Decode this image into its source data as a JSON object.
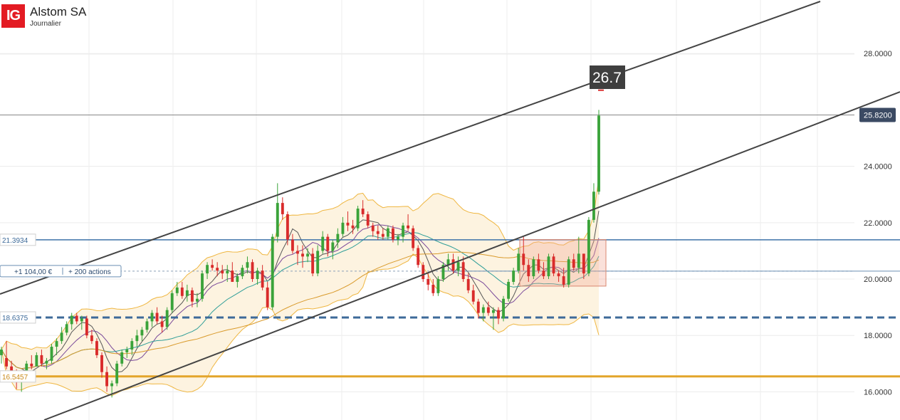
{
  "header": {
    "logo": "IG",
    "title": "Alstom SA",
    "subtitle": "Journalier"
  },
  "chart_data": {
    "type": "candlestick",
    "title": "Alstom SA",
    "subtitle": "Journalier",
    "ylim": [
      15.0,
      29.9
    ],
    "y_ticks": [
      "28.0000",
      "24.0000",
      "22.0000",
      "20.0000",
      "18.0000",
      "16.0000"
    ],
    "y_tick_values": [
      28.0,
      24.0,
      22.0,
      20.0,
      18.0,
      16.0
    ],
    "grid": true,
    "last_price": 25.82,
    "last_price_label": "25.8200",
    "target_value": 26.7,
    "target_label": "26.7",
    "levels": [
      {
        "value": 21.3934,
        "label": "21.3934",
        "color": "#3d72a8",
        "style": "solid"
      },
      {
        "value": 18.6375,
        "label": "18.6375",
        "color": "#3d6a99",
        "style": "dashed"
      },
      {
        "value": 16.5457,
        "label": "16.5457",
        "color": "#e3a52b",
        "style": "solid"
      }
    ],
    "position": {
      "value": 20.28,
      "pnl_label": "+1 104,00 €",
      "size_label": "+ 200 actions",
      "color": "#2b4a6f"
    },
    "candle_colors": {
      "up": "#3aa33a",
      "down": "#d92b2b"
    },
    "candles": [
      [
        17.3,
        17.6,
        17.0,
        17.5
      ],
      [
        17.2,
        17.8,
        16.8,
        16.9
      ],
      [
        16.9,
        17.1,
        16.4,
        16.7
      ],
      [
        16.7,
        16.8,
        16.1,
        16.4
      ],
      [
        16.4,
        16.7,
        16.0,
        16.6
      ],
      [
        16.6,
        17.1,
        16.5,
        17.0
      ],
      [
        17.0,
        17.3,
        16.8,
        16.9
      ],
      [
        16.9,
        17.4,
        16.9,
        17.3
      ],
      [
        17.3,
        17.5,
        16.9,
        17.0
      ],
      [
        17.0,
        17.2,
        16.8,
        17.1
      ],
      [
        17.1,
        17.7,
        17.0,
        17.6
      ],
      [
        17.6,
        17.9,
        17.3,
        17.8
      ],
      [
        17.8,
        18.3,
        17.7,
        18.1
      ],
      [
        18.1,
        18.5,
        18.0,
        18.4
      ],
      [
        18.4,
        18.8,
        18.2,
        18.7
      ],
      [
        18.7,
        18.8,
        18.4,
        18.5
      ],
      [
        18.5,
        18.7,
        18.2,
        18.6
      ],
      [
        18.6,
        18.7,
        17.9,
        18.0
      ],
      [
        18.0,
        18.2,
        17.7,
        17.8
      ],
      [
        17.8,
        17.9,
        17.2,
        17.3
      ],
      [
        17.3,
        17.4,
        16.5,
        16.7
      ],
      [
        16.7,
        16.9,
        16.0,
        16.2
      ],
      [
        16.2,
        16.4,
        15.8,
        16.3
      ],
      [
        16.3,
        17.1,
        16.2,
        17.0
      ],
      [
        17.0,
        17.5,
        16.9,
        17.4
      ],
      [
        17.4,
        17.6,
        17.2,
        17.5
      ],
      [
        17.5,
        17.9,
        17.3,
        17.8
      ],
      [
        17.8,
        18.2,
        17.6,
        18.0
      ],
      [
        18.0,
        18.3,
        17.8,
        18.2
      ],
      [
        18.2,
        18.6,
        18.1,
        18.5
      ],
      [
        18.5,
        18.9,
        18.3,
        18.8
      ],
      [
        18.8,
        19.0,
        18.4,
        18.5
      ],
      [
        18.5,
        18.7,
        18.1,
        18.3
      ],
      [
        18.3,
        19.0,
        18.2,
        18.9
      ],
      [
        18.9,
        19.6,
        18.8,
        19.5
      ],
      [
        19.5,
        19.9,
        19.4,
        19.7
      ],
      [
        19.7,
        19.9,
        19.3,
        19.4
      ],
      [
        19.4,
        19.8,
        19.2,
        19.6
      ],
      [
        19.6,
        19.7,
        19.0,
        19.2
      ],
      [
        19.2,
        19.5,
        19.0,
        19.3
      ],
      [
        19.3,
        20.3,
        19.2,
        20.2
      ],
      [
        20.2,
        20.6,
        20.0,
        20.5
      ],
      [
        20.5,
        20.7,
        20.3,
        20.4
      ],
      [
        20.4,
        20.6,
        20.1,
        20.3
      ],
      [
        20.3,
        20.5,
        20.0,
        20.2
      ],
      [
        20.2,
        20.5,
        19.9,
        20.3
      ],
      [
        20.3,
        20.6,
        20.0,
        19.9
      ],
      [
        19.9,
        20.2,
        19.7,
        20.1
      ],
      [
        20.1,
        20.5,
        20.0,
        20.4
      ],
      [
        20.4,
        20.8,
        20.2,
        20.6
      ],
      [
        20.6,
        20.7,
        19.9,
        20.0
      ],
      [
        20.0,
        20.4,
        19.8,
        20.3
      ],
      [
        20.3,
        20.5,
        19.6,
        19.7
      ],
      [
        19.7,
        19.9,
        18.9,
        19.0
      ],
      [
        19.0,
        21.6,
        18.9,
        21.5
      ],
      [
        21.5,
        23.4,
        21.3,
        22.7
      ],
      [
        22.7,
        22.9,
        22.1,
        22.3
      ],
      [
        22.3,
        22.4,
        21.2,
        21.4
      ],
      [
        21.4,
        21.6,
        20.9,
        21.0
      ],
      [
        21.0,
        21.2,
        20.5,
        20.9
      ],
      [
        20.9,
        21.2,
        20.4,
        20.8
      ],
      [
        20.8,
        21.1,
        20.6,
        20.9
      ],
      [
        20.9,
        21.1,
        20.1,
        20.2
      ],
      [
        20.2,
        21.2,
        20.1,
        21.0
      ],
      [
        21.0,
        21.7,
        20.9,
        21.5
      ],
      [
        21.5,
        21.6,
        20.8,
        21.0
      ],
      [
        21.0,
        21.4,
        20.7,
        21.3
      ],
      [
        21.3,
        21.8,
        21.1,
        21.6
      ],
      [
        21.6,
        22.2,
        21.5,
        22.0
      ],
      [
        22.0,
        22.4,
        21.7,
        21.9
      ],
      [
        21.9,
        22.1,
        21.6,
        21.8
      ],
      [
        21.8,
        22.6,
        21.7,
        22.5
      ],
      [
        22.5,
        22.8,
        22.2,
        22.3
      ],
      [
        22.3,
        22.4,
        21.8,
        21.9
      ],
      [
        21.9,
        22.0,
        21.5,
        21.7
      ],
      [
        21.7,
        21.9,
        21.4,
        21.6
      ],
      [
        21.6,
        21.8,
        21.4,
        21.5
      ],
      [
        21.5,
        21.9,
        21.4,
        21.8
      ],
      [
        21.8,
        21.9,
        21.3,
        21.4
      ],
      [
        21.4,
        21.6,
        21.2,
        21.5
      ],
      [
        21.5,
        22.0,
        21.3,
        21.9
      ],
      [
        21.9,
        22.3,
        21.7,
        21.8
      ],
      [
        21.8,
        21.9,
        21.0,
        21.1
      ],
      [
        21.1,
        21.2,
        20.4,
        20.5
      ],
      [
        20.5,
        20.6,
        19.9,
        20.0
      ],
      [
        20.0,
        20.2,
        19.6,
        19.8
      ],
      [
        19.8,
        20.0,
        19.4,
        19.5
      ],
      [
        19.5,
        20.1,
        19.4,
        20.0
      ],
      [
        20.0,
        20.6,
        19.9,
        20.5
      ],
      [
        20.5,
        20.9,
        20.3,
        20.7
      ],
      [
        20.7,
        20.9,
        20.2,
        20.3
      ],
      [
        20.3,
        20.8,
        20.1,
        20.6
      ],
      [
        20.6,
        20.8,
        19.9,
        20.0
      ],
      [
        20.0,
        20.2,
        19.5,
        19.6
      ],
      [
        19.6,
        19.8,
        19.1,
        19.2
      ],
      [
        19.2,
        19.3,
        18.6,
        18.8
      ],
      [
        18.8,
        19.1,
        18.5,
        19.0
      ],
      [
        19.0,
        19.2,
        18.7,
        18.8
      ],
      [
        18.8,
        19.0,
        18.2,
        18.9
      ],
      [
        18.9,
        19.0,
        18.4,
        18.6
      ],
      [
        18.6,
        19.4,
        18.5,
        19.3
      ],
      [
        19.3,
        20.0,
        19.2,
        19.9
      ],
      [
        19.9,
        20.4,
        19.8,
        20.3
      ],
      [
        20.3,
        21.1,
        20.2,
        20.9
      ],
      [
        20.9,
        21.5,
        20.3,
        20.5
      ],
      [
        20.5,
        20.7,
        19.9,
        20.1
      ],
      [
        20.1,
        20.8,
        20.0,
        20.7
      ],
      [
        20.7,
        20.9,
        20.2,
        20.3
      ],
      [
        20.3,
        20.6,
        20.0,
        20.1
      ],
      [
        20.1,
        20.9,
        20.0,
        20.8
      ],
      [
        20.8,
        20.9,
        20.1,
        20.2
      ],
      [
        20.2,
        20.3,
        19.9,
        20.1
      ],
      [
        20.1,
        20.4,
        19.7,
        19.8
      ],
      [
        19.8,
        20.8,
        19.7,
        20.7
      ],
      [
        20.7,
        20.9,
        20.3,
        20.4
      ],
      [
        20.4,
        21.5,
        20.2,
        20.9
      ],
      [
        20.9,
        20.9,
        20.0,
        20.2
      ],
      [
        20.2,
        22.2,
        20.1,
        22.1
      ],
      [
        22.1,
        23.4,
        22.0,
        23.1
      ],
      [
        23.1,
        26.0,
        23.0,
        25.8
      ]
    ],
    "overlay_colors": {
      "bollinger": "#efb640",
      "bollinger_fill": "#fdf3e0",
      "ma_fast": "#555555",
      "ma_slow": "#2f9e98",
      "ma_long": "#d99a2b"
    },
    "channel": {
      "color": "#444444"
    },
    "consolidation_box": {
      "low": 19.75,
      "high": 21.4,
      "color": "#f0b8a8"
    }
  }
}
